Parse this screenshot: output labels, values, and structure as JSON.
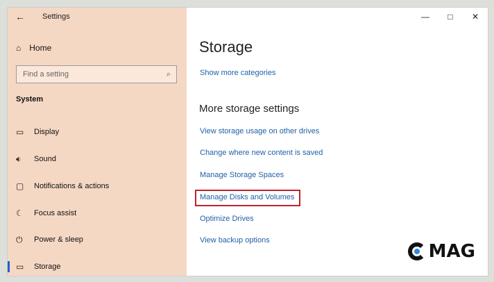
{
  "window": {
    "app_title": "Settings",
    "controls": {
      "minimize": "—",
      "maximize": "□",
      "close": "✕"
    }
  },
  "sidebar": {
    "home_label": "Home",
    "search_placeholder": "Find a setting",
    "section_title": "System",
    "items": [
      {
        "label": "Display",
        "icon": "display-icon",
        "glyph": "▭"
      },
      {
        "label": "Sound",
        "icon": "speaker-icon",
        "glyph": "🔈"
      },
      {
        "label": "Notifications & actions",
        "icon": "notification-icon",
        "glyph": "▢"
      },
      {
        "label": "Focus assist",
        "icon": "moon-icon",
        "glyph": "☾"
      },
      {
        "label": "Power & sleep",
        "icon": "power-icon",
        "glyph": "⏻"
      },
      {
        "label": "Storage",
        "icon": "storage-icon",
        "glyph": "▭",
        "selected": true
      }
    ]
  },
  "main": {
    "page_title": "Storage",
    "show_more": "Show more categories",
    "more_heading": "More storage settings",
    "links": [
      "View storage usage on other drives",
      "Change where new content is saved",
      "Manage Storage Spaces",
      "Manage Disks and Volumes",
      "Optimize Drives",
      "View backup options"
    ],
    "highlighted_link_index": 3
  },
  "watermark": {
    "text": "MAG"
  },
  "colors": {
    "sidebar_bg": "#f5d8c4",
    "link": "#1f5fa8",
    "highlight_border": "#c0212e",
    "selection_bar": "#1e62c6"
  }
}
